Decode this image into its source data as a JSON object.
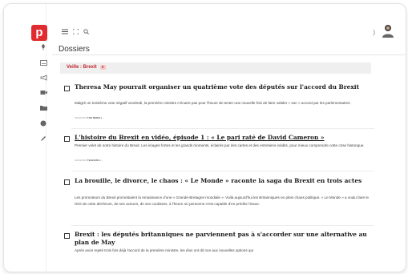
{
  "app": {
    "logo_letter": "p"
  },
  "header": {
    "page_title": "Dossiers"
  },
  "topbar": {
    "menu_icon": "hamburger-menu-icon",
    "expand_icon": "fullscreen-icon",
    "search_icon": "search-icon",
    "notification_dot": ")"
  },
  "sidebar": {
    "items": [
      {
        "icon": "pin-icon"
      },
      {
        "icon": "keyboard-icon"
      },
      {
        "icon": "megaphone-icon"
      },
      {
        "icon": "video-icon"
      },
      {
        "icon": "folder-icon"
      },
      {
        "icon": "globe-icon"
      },
      {
        "icon": "pen-icon"
      }
    ]
  },
  "filter": {
    "tag_label": "Veille : Brexit",
    "remove_symbol": "x"
  },
  "articles": [
    {
      "title": "Theresa May pourrait organiser un quatrième vote des députés sur l'accord du Brexit",
      "excerpt": "Malgré un troisième vote négatif vendredi, la première ministre n'écarte pas pour l'heure de tenter une nouvelle fois de faire valider « son » accord par les parlementaires.",
      "date": "30/03/2019",
      "source": "THE NEWS",
      "extra": "■ ~"
    },
    {
      "title": "L'histoire du Brexit en vidéo, épisode 1 : « Le pari raté de David Cameron »",
      "excerpt": "Premier volet de notre histoire du Brexit. Les images fortes et les grands moments, éclairés par des cartes et des entretiens inédits, pour mieux comprendre cette crise historique.",
      "date": "21/03/2019",
      "source": "TELEVIZE",
      "extra": "■ ~"
    },
    {
      "title": "La brouille, le divorce, le chaos : « Le Monde » raconte la saga du Brexit en trois actes",
      "excerpt": "Les promoteurs du Brexit promettaient la renaissance d'une « Grande-Bretagne mondiale ». Voilà aujourd'hui les Britanniques en plein chaos politique. « Le Monde » a voulu faire le récit de cette déchirure, de ses acteurs, de ses coulisses, à l'heure où personne n'est capable d'en prédire l'issue."
    },
    {
      "title": "Brexit : les députés britanniques ne parviennent pas à s'accorder sur une alternative au plan de May",
      "excerpt": "Après avoir rejeté trois fois déjà l'accord de la première ministre, les élus ont dit non aux nouvelles options qui"
    }
  ]
}
